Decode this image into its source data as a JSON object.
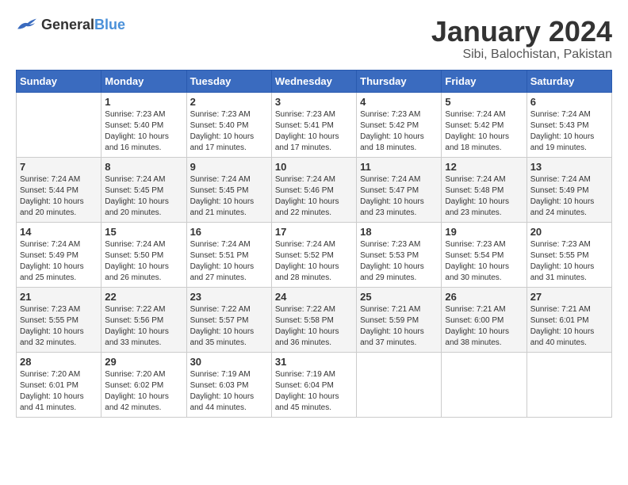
{
  "header": {
    "logo_general": "General",
    "logo_blue": "Blue",
    "month_title": "January 2024",
    "location": "Sibi, Balochistan, Pakistan"
  },
  "calendar": {
    "days_of_week": [
      "Sunday",
      "Monday",
      "Tuesday",
      "Wednesday",
      "Thursday",
      "Friday",
      "Saturday"
    ],
    "weeks": [
      [
        {
          "day": "",
          "sunrise": "",
          "sunset": "",
          "daylight": ""
        },
        {
          "day": "1",
          "sunrise": "Sunrise: 7:23 AM",
          "sunset": "Sunset: 5:40 PM",
          "daylight": "Daylight: 10 hours and 16 minutes."
        },
        {
          "day": "2",
          "sunrise": "Sunrise: 7:23 AM",
          "sunset": "Sunset: 5:40 PM",
          "daylight": "Daylight: 10 hours and 17 minutes."
        },
        {
          "day": "3",
          "sunrise": "Sunrise: 7:23 AM",
          "sunset": "Sunset: 5:41 PM",
          "daylight": "Daylight: 10 hours and 17 minutes."
        },
        {
          "day": "4",
          "sunrise": "Sunrise: 7:23 AM",
          "sunset": "Sunset: 5:42 PM",
          "daylight": "Daylight: 10 hours and 18 minutes."
        },
        {
          "day": "5",
          "sunrise": "Sunrise: 7:24 AM",
          "sunset": "Sunset: 5:42 PM",
          "daylight": "Daylight: 10 hours and 18 minutes."
        },
        {
          "day": "6",
          "sunrise": "Sunrise: 7:24 AM",
          "sunset": "Sunset: 5:43 PM",
          "daylight": "Daylight: 10 hours and 19 minutes."
        }
      ],
      [
        {
          "day": "7",
          "sunrise": "Sunrise: 7:24 AM",
          "sunset": "Sunset: 5:44 PM",
          "daylight": "Daylight: 10 hours and 20 minutes."
        },
        {
          "day": "8",
          "sunrise": "Sunrise: 7:24 AM",
          "sunset": "Sunset: 5:45 PM",
          "daylight": "Daylight: 10 hours and 20 minutes."
        },
        {
          "day": "9",
          "sunrise": "Sunrise: 7:24 AM",
          "sunset": "Sunset: 5:45 PM",
          "daylight": "Daylight: 10 hours and 21 minutes."
        },
        {
          "day": "10",
          "sunrise": "Sunrise: 7:24 AM",
          "sunset": "Sunset: 5:46 PM",
          "daylight": "Daylight: 10 hours and 22 minutes."
        },
        {
          "day": "11",
          "sunrise": "Sunrise: 7:24 AM",
          "sunset": "Sunset: 5:47 PM",
          "daylight": "Daylight: 10 hours and 23 minutes."
        },
        {
          "day": "12",
          "sunrise": "Sunrise: 7:24 AM",
          "sunset": "Sunset: 5:48 PM",
          "daylight": "Daylight: 10 hours and 23 minutes."
        },
        {
          "day": "13",
          "sunrise": "Sunrise: 7:24 AM",
          "sunset": "Sunset: 5:49 PM",
          "daylight": "Daylight: 10 hours and 24 minutes."
        }
      ],
      [
        {
          "day": "14",
          "sunrise": "Sunrise: 7:24 AM",
          "sunset": "Sunset: 5:49 PM",
          "daylight": "Daylight: 10 hours and 25 minutes."
        },
        {
          "day": "15",
          "sunrise": "Sunrise: 7:24 AM",
          "sunset": "Sunset: 5:50 PM",
          "daylight": "Daylight: 10 hours and 26 minutes."
        },
        {
          "day": "16",
          "sunrise": "Sunrise: 7:24 AM",
          "sunset": "Sunset: 5:51 PM",
          "daylight": "Daylight: 10 hours and 27 minutes."
        },
        {
          "day": "17",
          "sunrise": "Sunrise: 7:24 AM",
          "sunset": "Sunset: 5:52 PM",
          "daylight": "Daylight: 10 hours and 28 minutes."
        },
        {
          "day": "18",
          "sunrise": "Sunrise: 7:23 AM",
          "sunset": "Sunset: 5:53 PM",
          "daylight": "Daylight: 10 hours and 29 minutes."
        },
        {
          "day": "19",
          "sunrise": "Sunrise: 7:23 AM",
          "sunset": "Sunset: 5:54 PM",
          "daylight": "Daylight: 10 hours and 30 minutes."
        },
        {
          "day": "20",
          "sunrise": "Sunrise: 7:23 AM",
          "sunset": "Sunset: 5:55 PM",
          "daylight": "Daylight: 10 hours and 31 minutes."
        }
      ],
      [
        {
          "day": "21",
          "sunrise": "Sunrise: 7:23 AM",
          "sunset": "Sunset: 5:55 PM",
          "daylight": "Daylight: 10 hours and 32 minutes."
        },
        {
          "day": "22",
          "sunrise": "Sunrise: 7:22 AM",
          "sunset": "Sunset: 5:56 PM",
          "daylight": "Daylight: 10 hours and 33 minutes."
        },
        {
          "day": "23",
          "sunrise": "Sunrise: 7:22 AM",
          "sunset": "Sunset: 5:57 PM",
          "daylight": "Daylight: 10 hours and 35 minutes."
        },
        {
          "day": "24",
          "sunrise": "Sunrise: 7:22 AM",
          "sunset": "Sunset: 5:58 PM",
          "daylight": "Daylight: 10 hours and 36 minutes."
        },
        {
          "day": "25",
          "sunrise": "Sunrise: 7:21 AM",
          "sunset": "Sunset: 5:59 PM",
          "daylight": "Daylight: 10 hours and 37 minutes."
        },
        {
          "day": "26",
          "sunrise": "Sunrise: 7:21 AM",
          "sunset": "Sunset: 6:00 PM",
          "daylight": "Daylight: 10 hours and 38 minutes."
        },
        {
          "day": "27",
          "sunrise": "Sunrise: 7:21 AM",
          "sunset": "Sunset: 6:01 PM",
          "daylight": "Daylight: 10 hours and 40 minutes."
        }
      ],
      [
        {
          "day": "28",
          "sunrise": "Sunrise: 7:20 AM",
          "sunset": "Sunset: 6:01 PM",
          "daylight": "Daylight: 10 hours and 41 minutes."
        },
        {
          "day": "29",
          "sunrise": "Sunrise: 7:20 AM",
          "sunset": "Sunset: 6:02 PM",
          "daylight": "Daylight: 10 hours and 42 minutes."
        },
        {
          "day": "30",
          "sunrise": "Sunrise: 7:19 AM",
          "sunset": "Sunset: 6:03 PM",
          "daylight": "Daylight: 10 hours and 44 minutes."
        },
        {
          "day": "31",
          "sunrise": "Sunrise: 7:19 AM",
          "sunset": "Sunset: 6:04 PM",
          "daylight": "Daylight: 10 hours and 45 minutes."
        },
        {
          "day": "",
          "sunrise": "",
          "sunset": "",
          "daylight": ""
        },
        {
          "day": "",
          "sunrise": "",
          "sunset": "",
          "daylight": ""
        },
        {
          "day": "",
          "sunrise": "",
          "sunset": "",
          "daylight": ""
        }
      ]
    ]
  }
}
